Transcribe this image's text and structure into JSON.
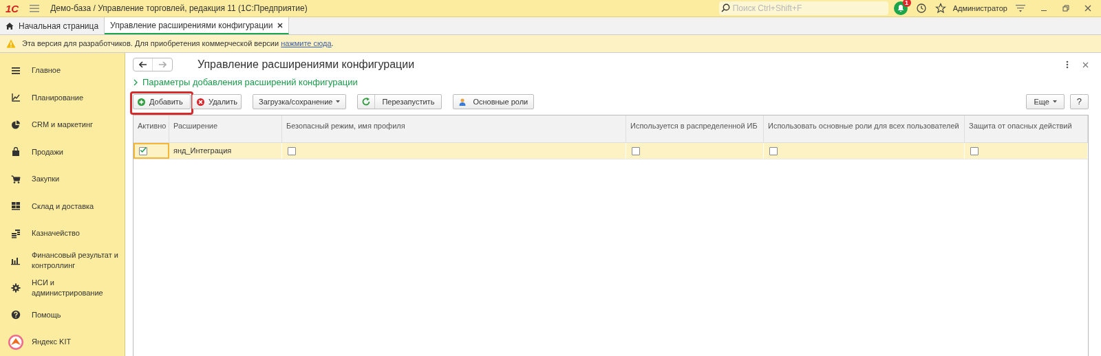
{
  "app": {
    "logo": "1С",
    "title": "Демо-база / Управление торговлей, редакция 11  (1С:Предприятие)"
  },
  "search": {
    "placeholder": "Поиск Ctrl+Shift+F"
  },
  "notifications": {
    "count": "1"
  },
  "user": "Администратор",
  "tabs": [
    {
      "label": "Начальная страница",
      "selected": false,
      "kind": "home"
    },
    {
      "label": "Управление расширениями конфигурации",
      "selected": true,
      "kind": "form"
    }
  ],
  "banner": {
    "text": "Эта версия для разработчиков. Для приобретения коммерческой версии",
    "link": "нажмите сюда",
    "suffix": "."
  },
  "sidebar": {
    "items": [
      {
        "label": "Главное"
      },
      {
        "label": "Планирование"
      },
      {
        "label": "CRM и маркетинг"
      },
      {
        "label": "Продажи"
      },
      {
        "label": "Закупки"
      },
      {
        "label": "Склад и доставка"
      },
      {
        "label": "Казначейство"
      },
      {
        "label": "Финансовый результат и контроллинг"
      },
      {
        "label": "НСИ и администрирование"
      },
      {
        "label": "Помощь"
      },
      {
        "label": "Яндекс KIT"
      }
    ]
  },
  "form": {
    "title": "Управление расширениями конфигурации",
    "section": {
      "label": "Параметры добавления расширений конфигурации",
      "expanded": false
    },
    "toolbar": [
      {
        "label": "Добавить",
        "kind": "add",
        "highlighted": true
      },
      {
        "label": "Удалить",
        "kind": "delete",
        "highlighted": false
      },
      {
        "label": "Загрузка/сохранение",
        "kind": "dropdown",
        "highlighted": false
      },
      {
        "label": "Перезапустить",
        "kind": "restart",
        "highlighted": false
      },
      {
        "label": "Основные роли",
        "kind": "roles",
        "highlighted": false
      }
    ],
    "more": "Еще",
    "help": "?",
    "table": {
      "columns": [
        "Активно",
        "Расширение",
        "Безопасный режим, имя профиля",
        "Используется в распределенной ИБ",
        "Использовать основные роли для всех пользователей",
        "Защита от опасных действий"
      ],
      "rows": [
        {
          "selected": true,
          "active": true,
          "name": "янд_Интеграция",
          "safe_mode": false,
          "distributed": false,
          "main_roles": false,
          "protection": false
        }
      ]
    }
  }
}
